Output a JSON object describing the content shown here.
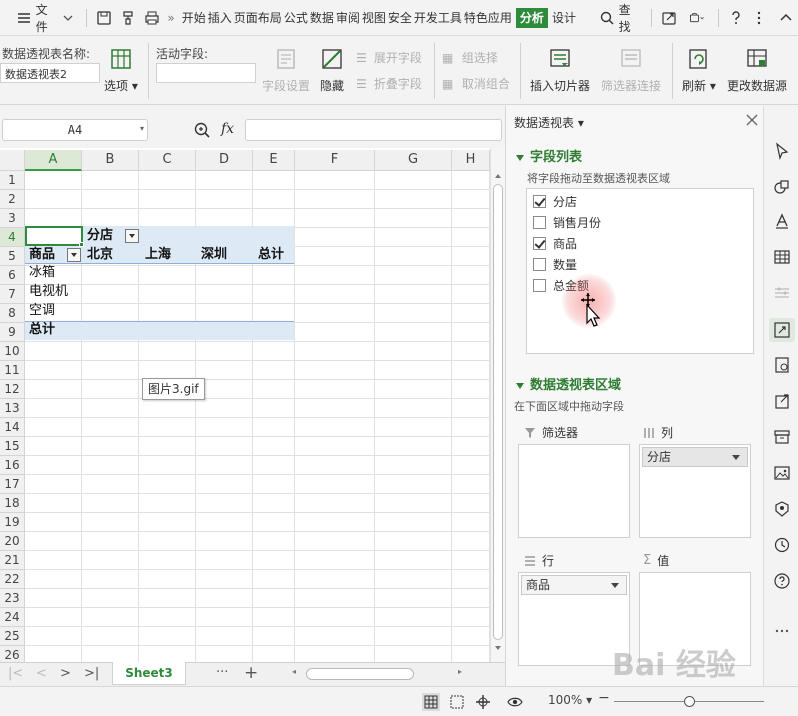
{
  "menubar": {
    "file_label": "文件",
    "tabs": [
      "开始",
      "插入",
      "页面布局",
      "公式",
      "数据",
      "审阅",
      "视图",
      "安全",
      "开发工具",
      "特色应用",
      "分析",
      "设计"
    ],
    "active_tab": "分析",
    "search_label": "查找",
    "more": "»"
  },
  "ribbon": {
    "pivot_name_label": "数据透视表名称:",
    "pivot_name_value": "数据透视表2",
    "options_label": "选项",
    "active_field_label": "活动字段:",
    "active_field_value": "",
    "field_settings_label": "字段设置",
    "hide_label": "隐藏",
    "expand_field_label": "展开字段",
    "collapse_field_label": "折叠字段",
    "group_selection_label": "组选择",
    "ungroup_label": "取消组合",
    "insert_slicer_label": "插入切片器",
    "filter_connections_label": "筛选器连接",
    "refresh_label": "刷新",
    "change_source_label": "更改数据源"
  },
  "formula": {
    "cell_ref": "A4",
    "fx_label": "fx",
    "content": ""
  },
  "grid": {
    "columns": [
      "A",
      "B",
      "C",
      "D",
      "E",
      "F",
      "G",
      "H"
    ],
    "rows": [
      "1",
      "2",
      "3",
      "4",
      "5",
      "6",
      "7",
      "8",
      "9",
      "10",
      "11",
      "12",
      "13",
      "14",
      "15",
      "16",
      "17",
      "18",
      "19",
      "20",
      "21",
      "22",
      "23",
      "24",
      "25",
      "26"
    ],
    "selected_column": "A",
    "selected_row": "4",
    "pivot": {
      "column_field": "分店",
      "row_field": "商品",
      "column_items": [
        "北京",
        "上海",
        "深圳"
      ],
      "grand_total_col": "总计",
      "row_items": [
        "冰箱",
        "电视机",
        "空调"
      ],
      "grand_total_row": "总计"
    },
    "tooltip": "图片3.gif"
  },
  "sheets": {
    "active": "Sheet3",
    "more": "···",
    "add": "+"
  },
  "status": {
    "zoom": "100%",
    "zoom_out": "−"
  },
  "pane": {
    "title": "数据透视表",
    "field_list_title": "字段列表",
    "field_list_hint": "将字段拖动至数据透视表区域",
    "fields": [
      {
        "label": "分店",
        "checked": true
      },
      {
        "label": "销售月份",
        "checked": false
      },
      {
        "label": "商品",
        "checked": true
      },
      {
        "label": "数量",
        "checked": false
      },
      {
        "label": "总金额",
        "checked": false
      }
    ],
    "areas_title": "数据透视表区域",
    "areas_hint": "在下面区域中拖动字段",
    "filter_label": "筛选器",
    "columns_label": "列",
    "rows_label": "行",
    "values_label": "值",
    "columns_chip": "分店",
    "rows_chip": "商品"
  },
  "watermark": "Bai 经验"
}
